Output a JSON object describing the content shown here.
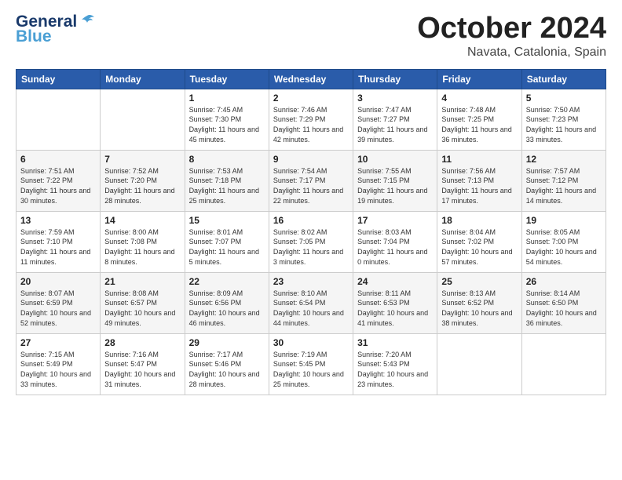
{
  "logo": {
    "line1": "General",
    "line2": "Blue"
  },
  "header": {
    "month": "October 2024",
    "location": "Navata, Catalonia, Spain"
  },
  "weekdays": [
    "Sunday",
    "Monday",
    "Tuesday",
    "Wednesday",
    "Thursday",
    "Friday",
    "Saturday"
  ],
  "weeks": [
    [
      {
        "day": "",
        "info": ""
      },
      {
        "day": "",
        "info": ""
      },
      {
        "day": "1",
        "info": "Sunrise: 7:45 AM\nSunset: 7:30 PM\nDaylight: 11 hours and 45 minutes."
      },
      {
        "day": "2",
        "info": "Sunrise: 7:46 AM\nSunset: 7:29 PM\nDaylight: 11 hours and 42 minutes."
      },
      {
        "day": "3",
        "info": "Sunrise: 7:47 AM\nSunset: 7:27 PM\nDaylight: 11 hours and 39 minutes."
      },
      {
        "day": "4",
        "info": "Sunrise: 7:48 AM\nSunset: 7:25 PM\nDaylight: 11 hours and 36 minutes."
      },
      {
        "day": "5",
        "info": "Sunrise: 7:50 AM\nSunset: 7:23 PM\nDaylight: 11 hours and 33 minutes."
      }
    ],
    [
      {
        "day": "6",
        "info": "Sunrise: 7:51 AM\nSunset: 7:22 PM\nDaylight: 11 hours and 30 minutes."
      },
      {
        "day": "7",
        "info": "Sunrise: 7:52 AM\nSunset: 7:20 PM\nDaylight: 11 hours and 28 minutes."
      },
      {
        "day": "8",
        "info": "Sunrise: 7:53 AM\nSunset: 7:18 PM\nDaylight: 11 hours and 25 minutes."
      },
      {
        "day": "9",
        "info": "Sunrise: 7:54 AM\nSunset: 7:17 PM\nDaylight: 11 hours and 22 minutes."
      },
      {
        "day": "10",
        "info": "Sunrise: 7:55 AM\nSunset: 7:15 PM\nDaylight: 11 hours and 19 minutes."
      },
      {
        "day": "11",
        "info": "Sunrise: 7:56 AM\nSunset: 7:13 PM\nDaylight: 11 hours and 17 minutes."
      },
      {
        "day": "12",
        "info": "Sunrise: 7:57 AM\nSunset: 7:12 PM\nDaylight: 11 hours and 14 minutes."
      }
    ],
    [
      {
        "day": "13",
        "info": "Sunrise: 7:59 AM\nSunset: 7:10 PM\nDaylight: 11 hours and 11 minutes."
      },
      {
        "day": "14",
        "info": "Sunrise: 8:00 AM\nSunset: 7:08 PM\nDaylight: 11 hours and 8 minutes."
      },
      {
        "day": "15",
        "info": "Sunrise: 8:01 AM\nSunset: 7:07 PM\nDaylight: 11 hours and 5 minutes."
      },
      {
        "day": "16",
        "info": "Sunrise: 8:02 AM\nSunset: 7:05 PM\nDaylight: 11 hours and 3 minutes."
      },
      {
        "day": "17",
        "info": "Sunrise: 8:03 AM\nSunset: 7:04 PM\nDaylight: 11 hours and 0 minutes."
      },
      {
        "day": "18",
        "info": "Sunrise: 8:04 AM\nSunset: 7:02 PM\nDaylight: 10 hours and 57 minutes."
      },
      {
        "day": "19",
        "info": "Sunrise: 8:05 AM\nSunset: 7:00 PM\nDaylight: 10 hours and 54 minutes."
      }
    ],
    [
      {
        "day": "20",
        "info": "Sunrise: 8:07 AM\nSunset: 6:59 PM\nDaylight: 10 hours and 52 minutes."
      },
      {
        "day": "21",
        "info": "Sunrise: 8:08 AM\nSunset: 6:57 PM\nDaylight: 10 hours and 49 minutes."
      },
      {
        "day": "22",
        "info": "Sunrise: 8:09 AM\nSunset: 6:56 PM\nDaylight: 10 hours and 46 minutes."
      },
      {
        "day": "23",
        "info": "Sunrise: 8:10 AM\nSunset: 6:54 PM\nDaylight: 10 hours and 44 minutes."
      },
      {
        "day": "24",
        "info": "Sunrise: 8:11 AM\nSunset: 6:53 PM\nDaylight: 10 hours and 41 minutes."
      },
      {
        "day": "25",
        "info": "Sunrise: 8:13 AM\nSunset: 6:52 PM\nDaylight: 10 hours and 38 minutes."
      },
      {
        "day": "26",
        "info": "Sunrise: 8:14 AM\nSunset: 6:50 PM\nDaylight: 10 hours and 36 minutes."
      }
    ],
    [
      {
        "day": "27",
        "info": "Sunrise: 7:15 AM\nSunset: 5:49 PM\nDaylight: 10 hours and 33 minutes."
      },
      {
        "day": "28",
        "info": "Sunrise: 7:16 AM\nSunset: 5:47 PM\nDaylight: 10 hours and 31 minutes."
      },
      {
        "day": "29",
        "info": "Sunrise: 7:17 AM\nSunset: 5:46 PM\nDaylight: 10 hours and 28 minutes."
      },
      {
        "day": "30",
        "info": "Sunrise: 7:19 AM\nSunset: 5:45 PM\nDaylight: 10 hours and 25 minutes."
      },
      {
        "day": "31",
        "info": "Sunrise: 7:20 AM\nSunset: 5:43 PM\nDaylight: 10 hours and 23 minutes."
      },
      {
        "day": "",
        "info": ""
      },
      {
        "day": "",
        "info": ""
      }
    ]
  ]
}
